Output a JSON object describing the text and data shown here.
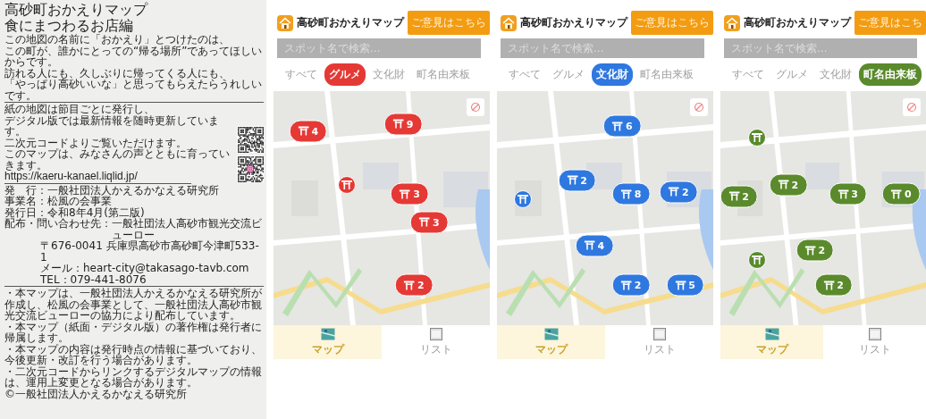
{
  "leaflet": {
    "title_lines": [
      "高砂町おかえりマップ",
      "食にまつわるお店編"
    ],
    "intro": [
      "この地図の名前に「おかえり」とつけたのは、",
      "この町が、誰かにとっての“帰る場所”であってほしいからです。",
      "訪れる人にも、久しぶりに帰ってくる人にも、",
      "「やっぱり高砂いいな」と思ってもらえたらうれしいです。"
    ],
    "digital": [
      "紙の地図は節目ごとに発行し、",
      "デジタル版では最新情報を随時更新しています。",
      "二次元コードよりご覧いただけます。",
      "このマップは、みなさんの声とともに育っていきます。"
    ],
    "url": "https://kaeru-kanael.liqlid.jp/",
    "info": [
      {
        "label": "発　行：",
        "value": "一般社団法人かえるかなえる研究所"
      },
      {
        "label": "事業名：",
        "value": "松風の会事業"
      },
      {
        "label": "発行日：",
        "value": "令和8年4月(第二版)"
      },
      {
        "label": "配布・問い合わせ先：",
        "value": "一般社団法人高砂市観光交流ビューロー"
      }
    ],
    "address": [
      "〒676-0041 兵庫県高砂市高砂町今津町533-1",
      "メール：heart-city@takasago-tavb.com",
      "TEL：079-441-8076"
    ],
    "notes": [
      "・本マップは、一般社団法人かえるかなえる研究所が作成し、松風の会事業として、一般社団法人高砂市観光交流ビューローの協力により配布しています。",
      "・本マップ（紙面・デジタル版）の著作権は発行者に帰属します。",
      "・本マップの内容は発行時点の情報に基づいており、今後更新・改訂を行う場合があります。",
      "・二次元コードからリンクするデジタルマップの情報は、運用上変更となる場合があります。",
      "©一般社団法人かえるかなえる研究所"
    ]
  },
  "phones": [
    {
      "title": "高砂町おかえりマップ",
      "feedback_button": "ご意見はこちら",
      "search": {
        "placeholder": "スポット名で検索..."
      },
      "color": "#e53935",
      "tabs": [
        {
          "label": "すべて",
          "selected": false
        },
        {
          "label": "グルメ",
          "selected": true
        },
        {
          "label": "文化財",
          "selected": false
        },
        {
          "label": "町名由来板",
          "selected": false
        }
      ],
      "markers": [
        {
          "kind": "cluster",
          "count": "4"
        },
        {
          "kind": "cluster",
          "count": "9"
        },
        {
          "kind": "single"
        },
        {
          "kind": "cluster",
          "count": "3"
        },
        {
          "kind": "cluster",
          "count": "3"
        },
        {
          "kind": "cluster",
          "count": "2"
        }
      ],
      "nav": [
        {
          "label": "マップ",
          "selected": true
        },
        {
          "label": "リスト",
          "selected": false
        }
      ]
    },
    {
      "title": "高砂町おかえりマップ",
      "feedback_button": "ご意見はこちら",
      "search": {
        "placeholder": "スポット名で検索..."
      },
      "color": "#2f78e0",
      "tabs": [
        {
          "label": "すべて",
          "selected": false
        },
        {
          "label": "グルメ",
          "selected": false
        },
        {
          "label": "文化財",
          "selected": true
        },
        {
          "label": "町名由来板",
          "selected": false
        }
      ],
      "markers": [
        {
          "kind": "cluster",
          "count": "6"
        },
        {
          "kind": "cluster",
          "count": "2"
        },
        {
          "kind": "single"
        },
        {
          "kind": "cluster",
          "count": "8"
        },
        {
          "kind": "cluster",
          "count": "2"
        },
        {
          "kind": "cluster",
          "count": "4"
        },
        {
          "kind": "cluster",
          "count": "2"
        },
        {
          "kind": "cluster",
          "count": "5"
        }
      ],
      "nav": [
        {
          "label": "マップ",
          "selected": true
        },
        {
          "label": "リスト",
          "selected": false
        }
      ]
    },
    {
      "title": "高砂町おかえりマップ",
      "feedback_button": "ご意見はこち",
      "search": {
        "placeholder": "スポット名で検索..."
      },
      "color": "#5a8a2c",
      "tabs": [
        {
          "label": "すべて",
          "selected": false
        },
        {
          "label": "グルメ",
          "selected": false
        },
        {
          "label": "文化財",
          "selected": false
        },
        {
          "label": "町名由来板",
          "selected": true
        }
      ],
      "markers": [
        {
          "kind": "single"
        },
        {
          "kind": "cluster",
          "count": "2"
        },
        {
          "kind": "cluster",
          "count": "2"
        },
        {
          "kind": "cluster",
          "count": "3"
        },
        {
          "kind": "cluster",
          "count": "0"
        },
        {
          "kind": "cluster",
          "count": "2"
        },
        {
          "kind": "cluster",
          "count": "2"
        },
        {
          "kind": "single"
        }
      ],
      "nav": [
        {
          "label": "マップ",
          "selected": true
        },
        {
          "label": "リスト",
          "selected": false
        }
      ]
    }
  ]
}
